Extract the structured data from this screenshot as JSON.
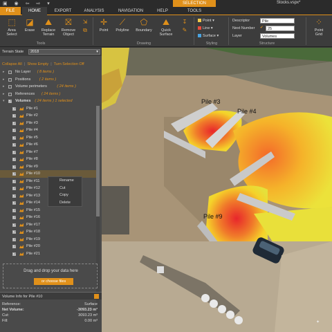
{
  "window": {
    "quick_access": "▣ ◉ ⇦ ⇨ ▾",
    "context_tab": "SELECTION",
    "document_title": "Stocks.vspx*"
  },
  "tabs": [
    "FILE",
    "HOME",
    "EXPORT",
    "ANALYSIS",
    "NAVIGATION",
    "HELP",
    "TOOLS"
  ],
  "ribbon": {
    "tools": [
      "Area\nSelect",
      "Erase",
      "Replace\nTerrain",
      "Remove\nObject"
    ],
    "tools_group": "Tools",
    "drawing": [
      "Point",
      "Polyline",
      "Boundary",
      "Quick\nSurface"
    ],
    "drawing_group": "Drawing",
    "styling": [
      "Point ▾",
      "Line ▾",
      "Surface ▾"
    ],
    "styling_group": "Styling",
    "structure_labels": [
      "Descriptor",
      "Next Number",
      "Layer"
    ],
    "descriptor_value": "Pile",
    "next_number_value": "25",
    "layer_value": "Volumes",
    "structure_group": "Structure",
    "point_grid": "Point\nGrid"
  },
  "left_panel": {
    "terrain_label": "Terrain State",
    "terrain_value": "2018",
    "links": [
      "Collapse All",
      "Show Empty",
      "Turn Selection Off"
    ],
    "tree": [
      {
        "label": "No Layer",
        "count": "( 8 items )"
      },
      {
        "label": "Positions",
        "count": "( 2 items )"
      },
      {
        "label": "Volume perimeters",
        "count": "( 24 items )"
      },
      {
        "label": "References",
        "count": "( 24 items )"
      },
      {
        "label": "Volumes",
        "count": "( 24 items ) 1 selected"
      }
    ],
    "piles": [
      "Pile #1",
      "Pile #2",
      "Pile #3",
      "Pile #4",
      "Pile #5",
      "Pile #6",
      "Pile #7",
      "Pile #8",
      "Pile #9",
      "Pile #10",
      "Pile #11",
      "Pile #12",
      "Pile #13",
      "Pile #14",
      "Pile #15",
      "Pile #16",
      "Pile #17",
      "Pile #18",
      "Pile #19",
      "Pile #20",
      "Pile #21"
    ],
    "context_menu": [
      "Rename",
      "Cut",
      "Copy",
      "Delete"
    ],
    "drop_text": "Drag and drop your data here",
    "drop_button": "or choose files",
    "volume_info_title": "Volume Info for Pile #10",
    "volume_info": [
      {
        "key": "Reference:",
        "value": "Surface"
      },
      {
        "key": "Net Volume:",
        "value": "-3093.23 m³"
      },
      {
        "key": "Cut:",
        "value": "3093.23 m³"
      },
      {
        "key": "Fill:",
        "value": "0.00 m³"
      }
    ]
  },
  "map": {
    "labels": [
      "Pile #3",
      "Pile #4",
      "Pile #9"
    ]
  },
  "colors": {
    "accent": "#e0901a"
  }
}
